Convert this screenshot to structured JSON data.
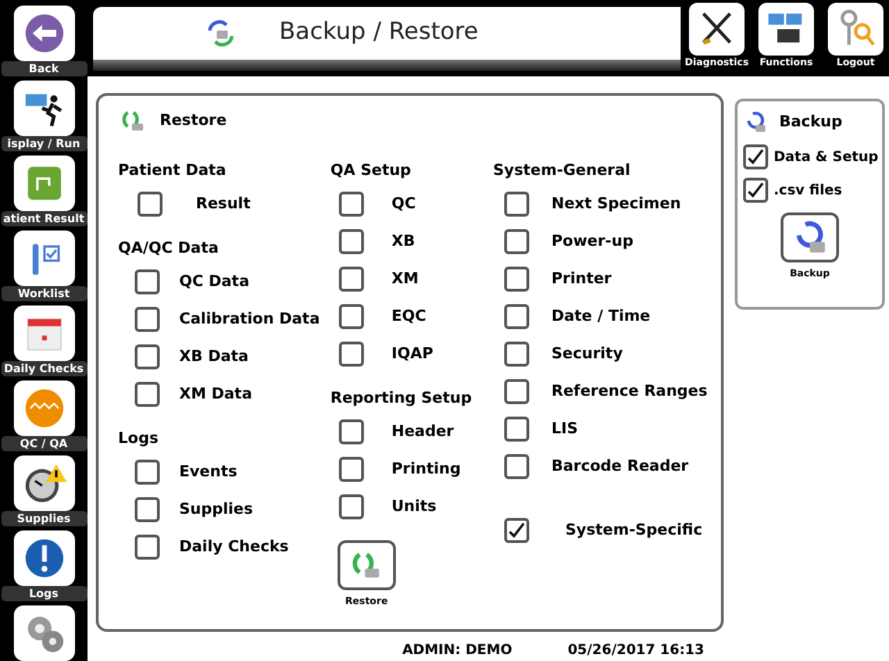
{
  "window": {
    "title": "Backup / Restore"
  },
  "sidebar": {
    "items": [
      {
        "label": "Back"
      },
      {
        "label": "isplay / Run"
      },
      {
        "label": "atient Result"
      },
      {
        "label": "Worklist"
      },
      {
        "label": "Daily Checks"
      },
      {
        "label": "QC / QA"
      },
      {
        "label": "Supplies"
      },
      {
        "label": "Logs"
      }
    ]
  },
  "toolbar": [
    "Diagnostics",
    "Functions",
    "Logout"
  ],
  "restore": {
    "title": "Restore",
    "columns": [
      [
        {
          "heading": "Patient Data",
          "items": [
            {
              "label": "Result",
              "checked": false
            }
          ]
        },
        {
          "heading": "QA/QC Data",
          "items": [
            {
              "label": "QC Data",
              "checked": false
            },
            {
              "label": "Calibration Data",
              "checked": false
            },
            {
              "label": "XB Data",
              "checked": false
            },
            {
              "label": "XM Data",
              "checked": false
            }
          ]
        },
        {
          "heading": "Logs",
          "items": [
            {
              "label": "Events",
              "checked": false
            },
            {
              "label": "Supplies",
              "checked": false
            },
            {
              "label": "Daily Checks",
              "checked": false
            }
          ]
        }
      ],
      [
        {
          "heading": "QA Setup",
          "items": [
            {
              "label": "QC",
              "checked": false
            },
            {
              "label": "XB",
              "checked": false
            },
            {
              "label": "XM",
              "checked": false
            },
            {
              "label": "EQC",
              "checked": false
            },
            {
              "label": "IQAP",
              "checked": false
            }
          ]
        },
        {
          "heading": "Reporting Setup",
          "items": [
            {
              "label": "Header",
              "checked": false
            },
            {
              "label": "Printing",
              "checked": false
            },
            {
              "label": "Units",
              "checked": false
            }
          ]
        }
      ],
      [
        {
          "heading": "System-General",
          "items": [
            {
              "label": "Next Specimen",
              "checked": false
            },
            {
              "label": "Power-up",
              "checked": false
            },
            {
              "label": "Printer",
              "checked": false
            },
            {
              "label": "Date / Time",
              "checked": false
            },
            {
              "label": "Security",
              "checked": false
            },
            {
              "label": "Reference Ranges",
              "checked": false
            },
            {
              "label": "LIS",
              "checked": false
            },
            {
              "label": "Barcode Reader",
              "checked": false
            }
          ]
        },
        {
          "items": [
            {
              "label": "System-Specific",
              "checked": true
            }
          ]
        }
      ]
    ],
    "button": "Restore"
  },
  "backup": {
    "title": "Backup",
    "items": [
      {
        "label": "Data & Setup",
        "checked": true
      },
      {
        "label": ".csv files",
        "checked": true
      }
    ],
    "button": "Backup"
  },
  "status_bar": {
    "user": "ADMIN: DEMO",
    "datetime": "05/26/2017 16:13"
  }
}
